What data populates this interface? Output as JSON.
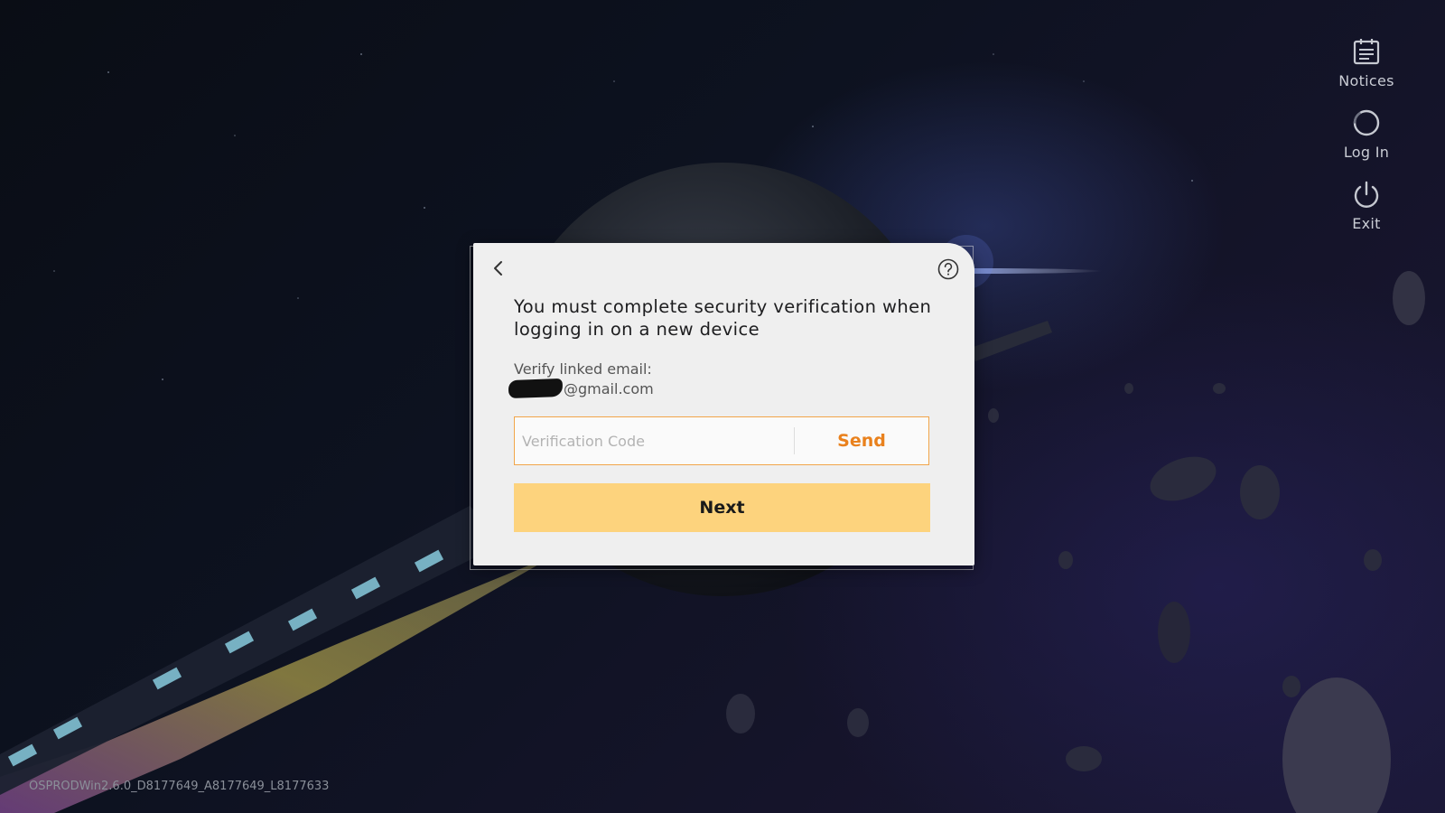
{
  "side_menu": {
    "notices_label": "Notices",
    "login_label": "Log In",
    "exit_label": "Exit"
  },
  "dialog": {
    "title": "You must complete security verification when logging in on a new device",
    "verify_label": "Verify linked email:",
    "email_suffix": "@gmail.com",
    "code_placeholder": "Verification Code",
    "code_value": "",
    "send_label": "Send",
    "next_label": "Next"
  },
  "version": "OSPRODWin2.6.0_D8177649_A8177649_L8177633",
  "colors": {
    "accent_orange": "#e9811d",
    "input_border": "#f2a54a",
    "next_button": "#fdd37d",
    "dialog_bg": "#efefef"
  },
  "icons": {
    "back": "chevron-left-icon",
    "help": "help-circle-icon",
    "notices": "notice-board-icon",
    "login": "login-ring-icon",
    "exit": "power-icon"
  }
}
